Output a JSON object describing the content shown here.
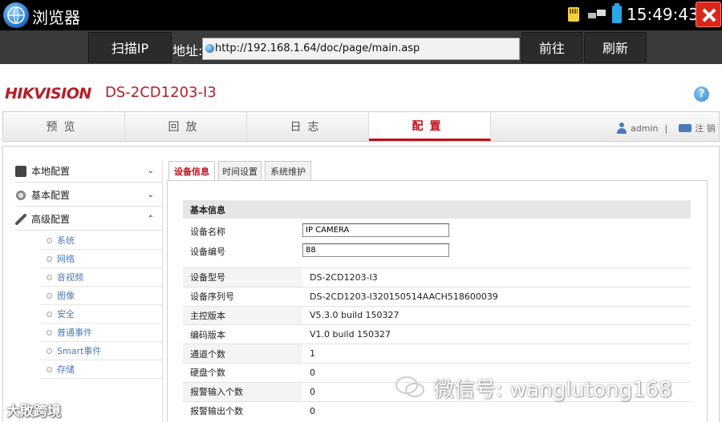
{
  "statusbar": {
    "app_title": "浏览器",
    "time": "15:49:43"
  },
  "toolbar": {
    "scan_label": "扫描IP",
    "address_label": "地址:",
    "url": "http://192.168.1.64/doc/page/main.asp",
    "go_label": "前往",
    "refresh_label": "刷新"
  },
  "header": {
    "brand": "HIKVISION",
    "model": "DS-2CD1203-I3",
    "help_symbol": "?"
  },
  "mainnav": {
    "tabs": [
      "预览",
      "回放",
      "日志",
      "配置"
    ],
    "active_tab": "配置",
    "user": "admin",
    "separator": "|",
    "logout": "注 销"
  },
  "sidebar": {
    "groups": [
      {
        "label": "本地配置",
        "icon": "monitor-icon",
        "chevron": "⌄"
      },
      {
        "label": "基本配置",
        "icon": "settings-icon",
        "chevron": "⌄"
      },
      {
        "label": "高级配置",
        "icon": "wrench-icon",
        "chevron": "⌃"
      }
    ],
    "items": [
      "系统",
      "网络",
      "音视频",
      "图像",
      "安全",
      "普通事件",
      "Smart事件",
      "存储"
    ]
  },
  "subtabs": [
    "设备信息",
    "时间设置",
    "系统维护"
  ],
  "form": {
    "section_title": "基本信息",
    "device_name_label": "设备名称",
    "device_name_value": "IP CAMERA",
    "device_no_label": "设备编号",
    "device_no_value": "88"
  },
  "info_rows": [
    {
      "k": "设备型号",
      "v": "DS-2CD1203-I3"
    },
    {
      "k": "设备序列号",
      "v": "DS-2CD1203-I320150514AACH518600039"
    },
    {
      "k": "主控版本",
      "v": "V5.3.0 build 150327"
    },
    {
      "k": "编码版本",
      "v": "V1.0 build 150327"
    },
    {
      "k": "通道个数",
      "v": "1"
    },
    {
      "k": "硬盘个数",
      "v": "0"
    },
    {
      "k": "报警输入个数",
      "v": "0"
    },
    {
      "k": "报警输出个数",
      "v": "0"
    }
  ],
  "watermarks": {
    "left": "大敗跨境",
    "right": "微信号: wanglutong168"
  },
  "colors": {
    "brand_red": "#b81c25",
    "active_tab_red": "#c0101c",
    "link_blue": "#4a7bb8",
    "close_red": "#d9261c"
  }
}
